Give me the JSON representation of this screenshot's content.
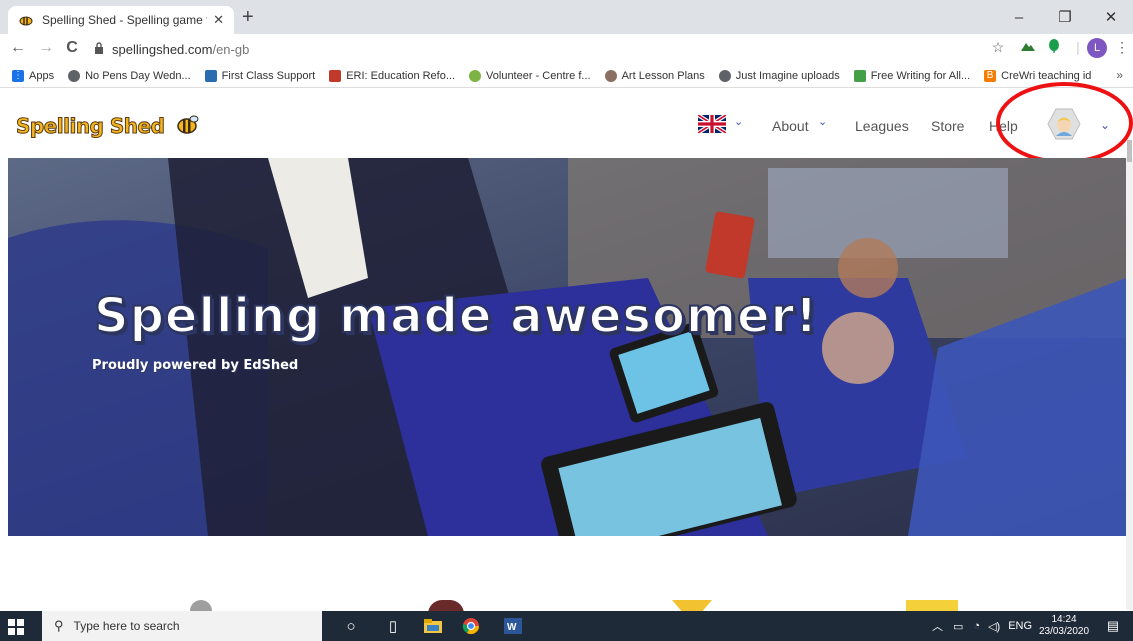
{
  "browser": {
    "tab_title": "Spelling Shed - Spelling game fo",
    "close_glyph": "✕",
    "newtab_glyph": "+",
    "url_host": "spellingshed.com",
    "url_path": "/en-gb",
    "minimize": "–",
    "restore": "❐",
    "close": "✕",
    "back": "←",
    "forward": "→",
    "reload": "C",
    "star": "☆",
    "profile_initial": "L",
    "menu": "⋮"
  },
  "bookmarks": [
    {
      "label": "Apps",
      "icon": "apps-grid-icon",
      "color": "#1a73e8"
    },
    {
      "label": "No Pens Day Wedn...",
      "icon": "globe-icon",
      "color": "#5f6368"
    },
    {
      "label": "First Class Support",
      "icon": "fcs-icon",
      "color": "#2b6cb0"
    },
    {
      "label": "ERI: Education Refo...",
      "icon": "shield-icon",
      "color": "#c0392b"
    },
    {
      "label": "Volunteer - Centre f...",
      "icon": "gear-icon",
      "color": "#7cb342"
    },
    {
      "label": "Art Lesson Plans",
      "icon": "palette-icon",
      "color": "#8d6e63"
    },
    {
      "label": "Just Imagine uploads",
      "icon": "globe-icon",
      "color": "#5f6368"
    },
    {
      "label": "Free Writing for All...",
      "icon": "leaf-icon",
      "color": "#43a047"
    },
    {
      "label": "CreWri teaching id",
      "icon": "blogger-icon",
      "color": "#f57c00"
    }
  ],
  "bookmarks_more": "»",
  "site": {
    "logo_text": "Spelling Shed",
    "nav": {
      "about": "About",
      "leagues": "Leagues",
      "store": "Store",
      "help": "Help"
    },
    "chevron": "⌄"
  },
  "hero": {
    "title": "Spelling made awesomer!",
    "subtitle": "Proudly powered by EdShed"
  },
  "taskbar": {
    "search_placeholder": "Type here to search",
    "tray_lang": "ENG",
    "time": "14:24",
    "date": "23/03/2020"
  },
  "colors": {
    "highlight_ring": "#ee1111",
    "nav_accent": "#3f51b5",
    "logo_yellow": "#f3b61f"
  }
}
